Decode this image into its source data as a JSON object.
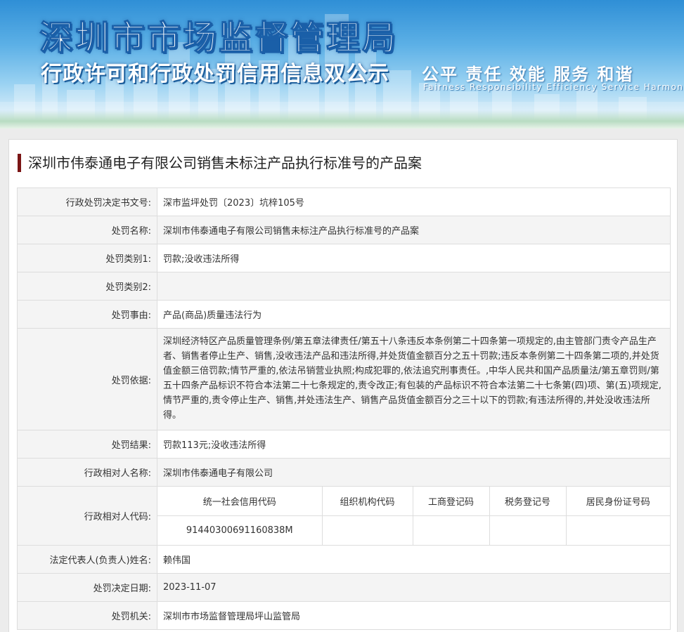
{
  "header": {
    "title": "深圳市市场监督管理局",
    "subtitle": "行政许可和行政处罚信用信息双公示",
    "slogan_cn": "公平  责任  效能  服务  和谐",
    "slogan_en": "Fairness  Responsibility  Efficiency  Service  Harmony"
  },
  "case": {
    "title": "深圳市伟泰通电子有限公司销售未标注产品执行标准号的产品案"
  },
  "fields": {
    "doc_no_label": "行政处罚决定书文号:",
    "doc_no": "深市监坪处罚〔2023〕坑梓105号",
    "name_label": "处罚名称:",
    "name": "深圳市伟泰通电子有限公司销售未标注产品执行标准号的产品案",
    "type1_label": "处罚类别1:",
    "type1": "罚款;没收违法所得",
    "type2_label": "处罚类别2:",
    "type2": "",
    "reason_label": "处罚事由:",
    "reason": "产品(商品)质量违法行为",
    "basis_label": "处罚依据:",
    "basis": "深圳经济特区产品质量管理条例/第五章法律责任/第五十八条违反本条例第二十四条第一项规定的,由主管部门责令产品生产者、销售者停止生产、销售,没收违法产品和违法所得,并处货值金额百分之五十罚款;违反本条例第二十四条第二项的,并处货值金额三倍罚款;情节严重的,依法吊销营业执照;构成犯罪的,依法追究刑事责任。,中华人民共和国产品质量法/第五章罚则/第五十四条产品标识不符合本法第二十七条规定的,责令改正;有包装的产品标识不符合本法第二十七条第(四)项、第(五)项规定,情节严重的,责令停止生产、销售,并处违法生产、销售产品货值金额百分之三十以下的罚款;有违法所得的,并处没收违法所得。",
    "result_label": "处罚结果:",
    "result": "罚款113元;没收违法所得",
    "party_label": "行政相对人名称:",
    "party": "深圳市伟泰通电子有限公司",
    "code_label": "行政相对人代码:",
    "codes_headers": [
      "统一社会信用代码",
      "组织机构代码",
      "工商登记码",
      "税务登记号",
      "居民身份证号码"
    ],
    "codes_values": [
      "91440300691160838M",
      "",
      "",
      "",
      ""
    ],
    "legal_rep_label": "法定代表人(负责人)姓名:",
    "legal_rep": "赖伟国",
    "date_label": "处罚决定日期:",
    "date": "2023-11-07",
    "authority_label": "处罚机关:",
    "authority": "深圳市市场监督管理局坪山监管局"
  },
  "colors": {
    "accent_bar": "#7a1515",
    "banner_top": "#2f8fd6"
  }
}
